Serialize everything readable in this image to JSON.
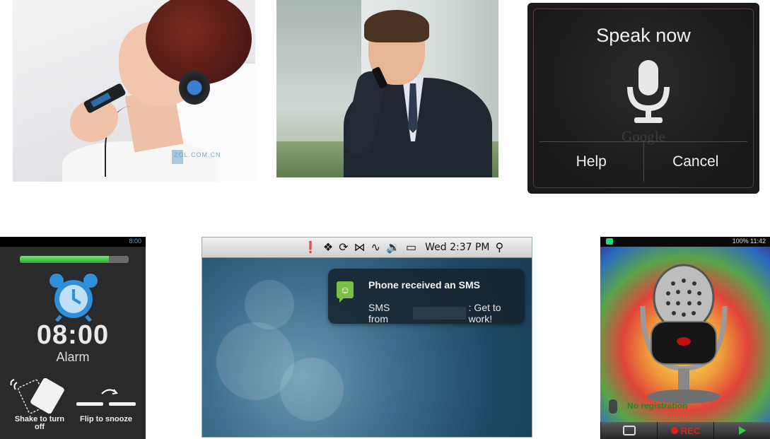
{
  "dialog": {
    "title": "Speak now",
    "brand": "Google",
    "help_label": "Help",
    "cancel_label": "Cancel"
  },
  "photo1": {
    "watermark": "ZOL.COM.CN"
  },
  "alarm": {
    "status_time": "8:00",
    "progress": 0.82,
    "time": "08:00",
    "label": "Alarm",
    "shake_caption": "Shake to turn off",
    "flip_caption": "Flip to snooze"
  },
  "desktop": {
    "menubar_time": "Wed 2:37 PM",
    "notification": {
      "title": "Phone received an SMS",
      "body_prefix": "SMS from",
      "body_suffix": ": Get to work!"
    }
  },
  "recorder": {
    "status_text": "100% 11:42",
    "status_label": "No registration",
    "rec_label": "REC"
  },
  "colors": {
    "alarm_progress": "#2fa834",
    "notification_icon": "#7cbf45",
    "rec_red": "#e02020",
    "clock_blue": "#2f8fd8"
  }
}
